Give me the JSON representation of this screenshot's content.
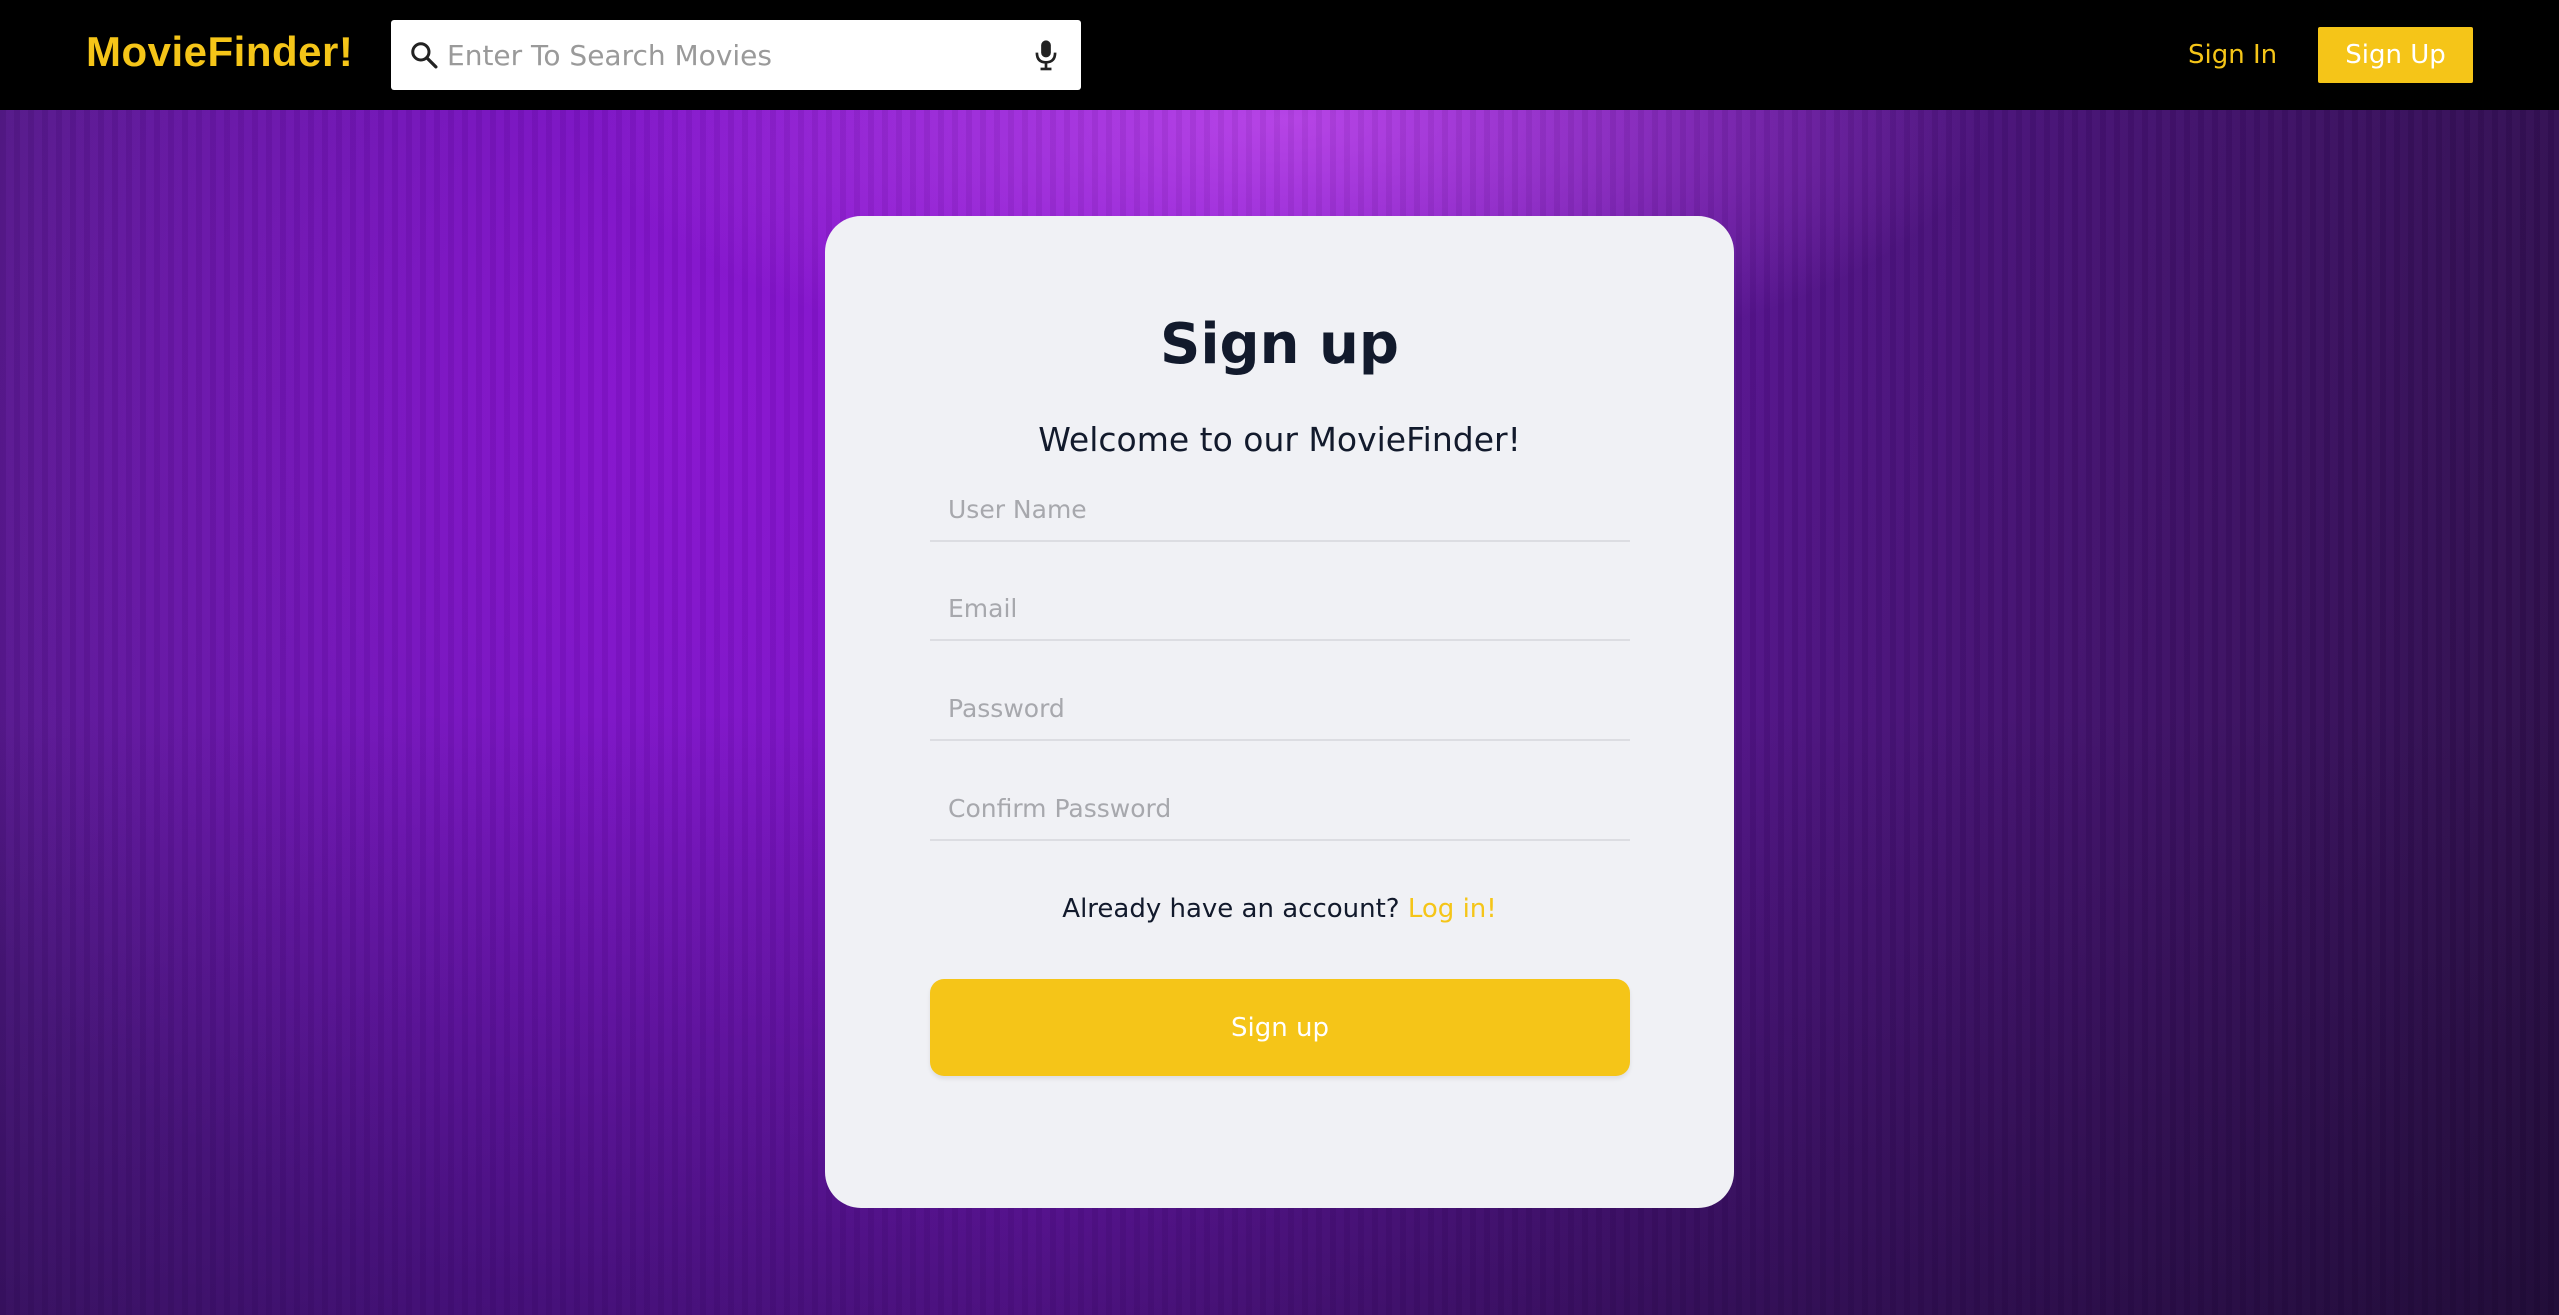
{
  "header": {
    "logo": "MovieFinder!",
    "search": {
      "placeholder": "Enter To Search Movies",
      "icon": "search-icon",
      "mic_icon": "microphone-icon"
    },
    "nav": {
      "sign_in": "Sign In",
      "sign_up": "Sign Up"
    }
  },
  "card": {
    "title": "Sign up",
    "subtitle": "Welcome to our MovieFinder!",
    "fields": {
      "username_placeholder": "User Name",
      "email_placeholder": "Email",
      "password_placeholder": "Password",
      "confirm_placeholder": "Confirm Password"
    },
    "account_prompt": "Already have an account?",
    "login_link": "Log in!",
    "submit": "Sign up"
  },
  "colors": {
    "accent": "#f5c518",
    "header_bg": "#000000",
    "card_bg": "#f0f1f5",
    "text_dark": "#121a2c"
  }
}
